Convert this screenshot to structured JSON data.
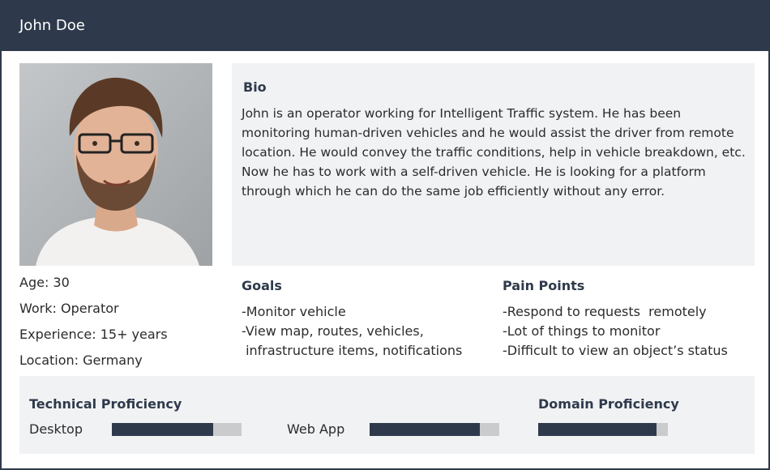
{
  "header": {
    "title": "John Doe"
  },
  "profile": {
    "photo_alt": "portrait photo",
    "facts": [
      "Age: 30",
      "Work: Operator",
      "Experience: 15+ years",
      "Location: Germany"
    ]
  },
  "bio": {
    "title": "Bio",
    "text": "John is an operator working for Intelligent Traffic system. He has been monitoring human-driven vehicles and he would assist the driver from remote location. He would convey the traffic conditions, help in vehicle breakdown, etc. Now he has to work with a self-driven vehicle. He is looking for a platform through which he can do the same job efficiently without any error."
  },
  "goals": {
    "title": "Goals",
    "items": [
      "-Monitor vehicle",
      "-View map, routes, vehicles,",
      " infrastructure items, notifications"
    ]
  },
  "pain_points": {
    "title": "Pain Points",
    "items": [
      "-Respond to requests  remotely",
      "-Lot of things to monitor",
      "-Difficult to view an object’s status"
    ]
  },
  "proficiency": {
    "technical_title": "Technical Proficiency",
    "domain_title": "Domain Proficiency",
    "skills": [
      {
        "label": "Desktop",
        "level": 0.78
      },
      {
        "label": "Web App",
        "level": 0.85
      }
    ],
    "domain_level": 0.91
  },
  "colors": {
    "dark": "#2e3a4b",
    "panel": "#f1f2f4",
    "bar_track": "#c9cbcd"
  }
}
